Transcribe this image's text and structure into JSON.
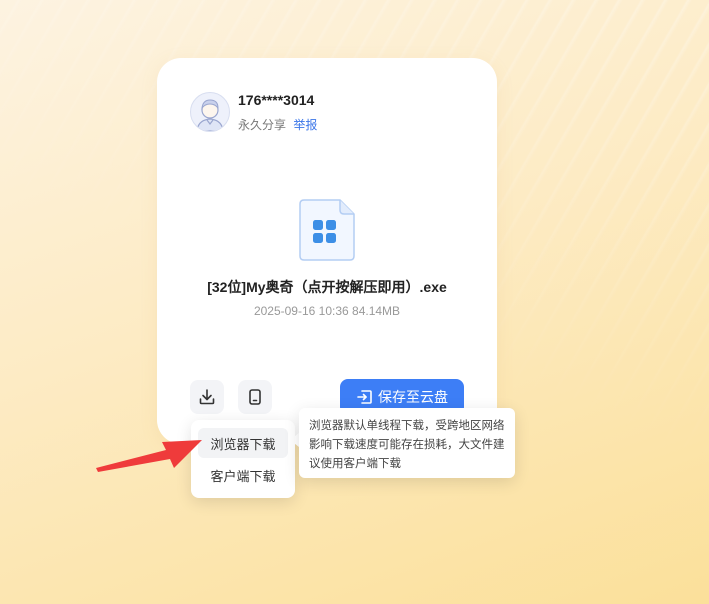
{
  "user": {
    "name": "176****3014",
    "share_type": "永久分享",
    "report_label": "举报"
  },
  "file": {
    "name": "[32位]My奥奇（点开按解压即用）.exe",
    "date": "2025-09-16 10:36",
    "size": "84.14MB",
    "icon": "app-file-icon"
  },
  "actions": {
    "download_icon": "download-icon",
    "device_icon": "device-icon",
    "save_label": "保存至云盘"
  },
  "download_menu": {
    "items": [
      {
        "label": "浏览器下载"
      },
      {
        "label": "客户端下载"
      }
    ]
  },
  "tooltip": {
    "text": "浏览器默认单线程下载，受跨地区网络影响下载速度可能存在损耗，大文件建议使用客户端下载"
  },
  "colors": {
    "accent": "#3d7ef6",
    "link": "#3a75e8",
    "annotation_arrow": "#ef3b3b"
  }
}
